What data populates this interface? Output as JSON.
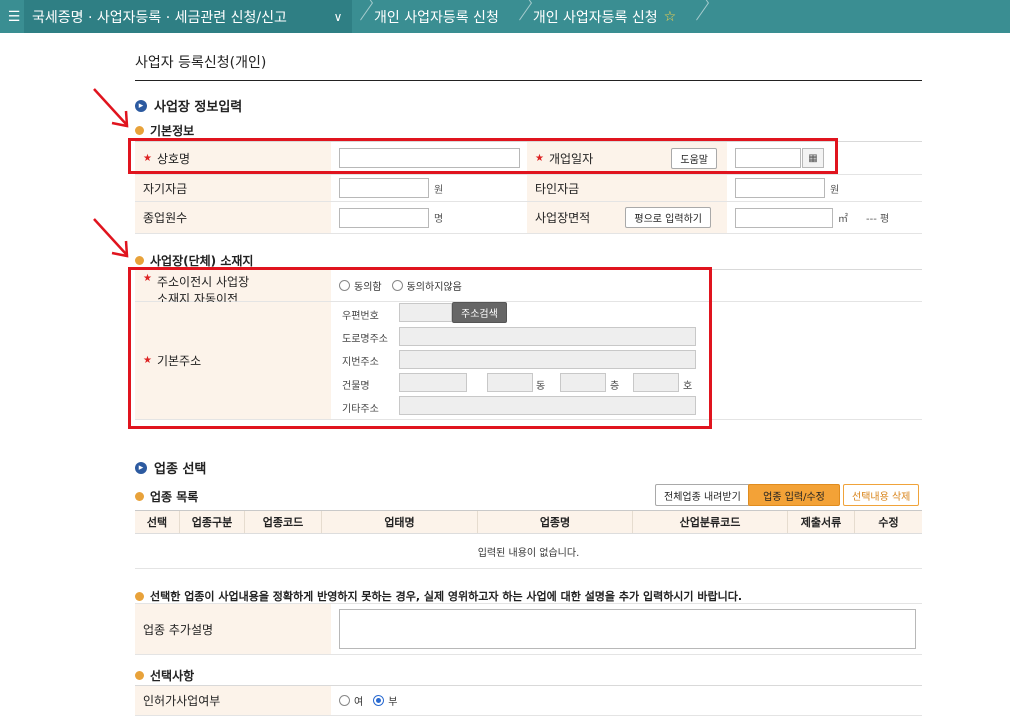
{
  "nav": {
    "menu_icon": "hamburger-icon",
    "home": "국세증명 · 사업자등록 · 세금관련 신청/신고",
    "crumb1": "개인 사업자등록 신청",
    "crumb2": "개인 사업자등록 신청"
  },
  "page": {
    "title": "사업자 등록신청(개인)"
  },
  "business_info": {
    "heading": "사업장 정보입력",
    "basic_heading": "기본정보",
    "trade_name_label": "상호명",
    "open_date_label": "개업일자",
    "help_button": "도움말",
    "own_capital_label": "자기자금",
    "other_capital_label": "타인자금",
    "won_unit": "원",
    "employees_label": "종업원수",
    "employees_unit": "명",
    "area_label": "사업장면적",
    "pyeong_button": "평으로 입력하기",
    "area_unit": "㎡",
    "pyeong_text": "--- 평"
  },
  "location": {
    "heading": "사업장(단체) 소재지",
    "auto_move_label_1": "주소이전시 사업장",
    "auto_move_label_2": "소재지 자동이전",
    "agree": "동의함",
    "disagree": "동의하지않음",
    "basic_addr_label": "기본주소",
    "zip_label": "우편번호",
    "search_button": "주소검색",
    "road_label": "도로명주소",
    "jibun_label": "지번주소",
    "building_label": "건물명",
    "dong": "동",
    "floor": "층",
    "ho": "호",
    "other_label": "기타주소"
  },
  "industry": {
    "heading": "업종 선택",
    "list_heading": "업종 목록",
    "btn_download": "전체업종 내려받기",
    "btn_input": "업종 입력/수정",
    "btn_delete": "선택내용 삭제",
    "columns": [
      "선택",
      "업종구분",
      "업종코드",
      "업태명",
      "업종명",
      "산업분류코드",
      "제출서류",
      "수정"
    ],
    "empty": "입력된 내용이 없습니다.",
    "note": "선택한 업종이 사업내용을 정확하게 반영하지 못하는 경우, 실제 영위하고자 하는 사업에 대한 설명을 추가 입력하시기 바랍니다.",
    "extra_label": "업종 추가설명"
  },
  "options": {
    "heading": "선택사항",
    "license_label": "인허가사업여부",
    "yes": "여",
    "no": "부"
  },
  "colors": {
    "nav": "#3a8e92",
    "highlight": "#e0141e",
    "accent": "#f0a33a"
  }
}
